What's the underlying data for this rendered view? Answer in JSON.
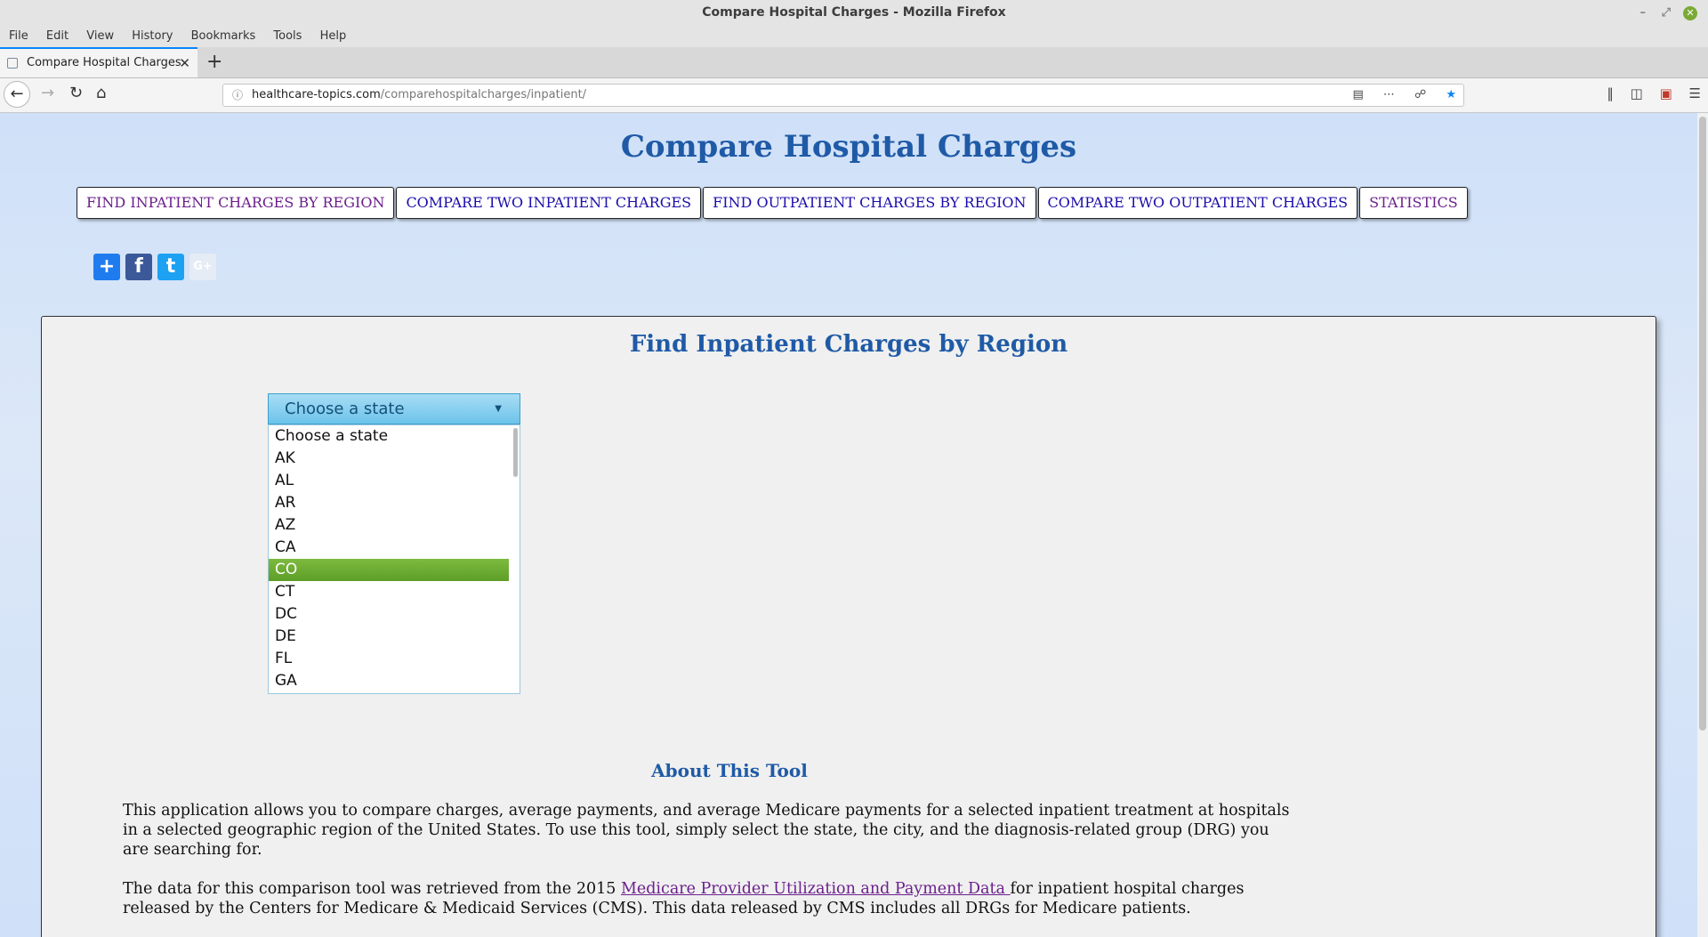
{
  "window": {
    "title": "Compare Hospital Charges - Mozilla Firefox",
    "min_glyph": "–",
    "max_glyph": "⤢",
    "close_glyph": "✕"
  },
  "menu": [
    "File",
    "Edit",
    "View",
    "History",
    "Bookmarks",
    "Tools",
    "Help"
  ],
  "tab": {
    "label": "Compare Hospital Charges",
    "close": "✕",
    "new_tab": "+"
  },
  "address": {
    "host": "healthcare-topics.com",
    "path": "/comparehospitalcharges/inpatient/"
  },
  "page": {
    "site_title": "Compare Hospital Charges",
    "nav": [
      "FIND INPATIENT CHARGES BY REGION",
      "COMPARE TWO INPATIENT CHARGES",
      "FIND OUTPATIENT CHARGES BY REGION",
      "COMPARE TWO OUTPATIENT CHARGES",
      "STATISTICS"
    ],
    "social": {
      "add": "+",
      "facebook": "f",
      "twitter": "t",
      "google": "G+"
    },
    "panel_title": "Find Inpatient Charges by Region",
    "select": {
      "current": "Choose a state",
      "options": [
        "Choose a state",
        "AK",
        "AL",
        "AR",
        "AZ",
        "CA",
        "CO",
        "CT",
        "DC",
        "DE",
        "FL",
        "GA"
      ],
      "highlighted": "CO"
    },
    "about": {
      "title": "About This Tool",
      "p1": "This application allows you to compare charges, average payments, and average Medicare payments for a selected inpatient treatment at hospitals in a selected geographic region of the United States. To use this tool, simply select the state, the city, and the diagnosis-related group (DRG) you are searching for.",
      "p2_before": "The data for this comparison tool was retrieved from the 2015 ",
      "p2_link": "Medicare Provider Utilization and Payment Data ",
      "p2_after": "for inpatient hospital charges released by the Centers for Medicare & Medicaid Services (CMS). This data released by CMS includes all DRGs for Medicare patients."
    }
  }
}
